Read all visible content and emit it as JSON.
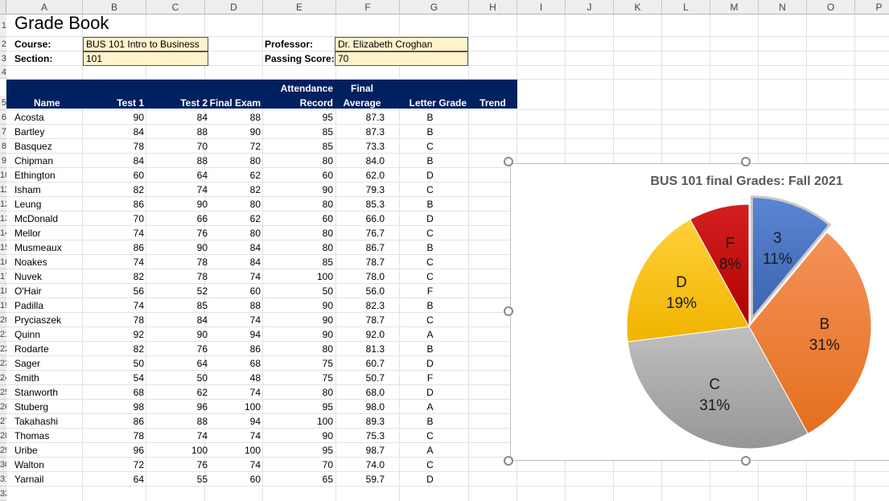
{
  "columns": [
    "A",
    "B",
    "C",
    "D",
    "E",
    "F",
    "G",
    "H",
    "I",
    "J",
    "K",
    "L",
    "M",
    "N",
    "O",
    "P"
  ],
  "row_numbers": [
    "1",
    "2",
    "3",
    "4",
    "5",
    "6",
    "7",
    "8",
    "9",
    "10",
    "11",
    "12",
    "13",
    "14",
    "15",
    "16",
    "17",
    "18",
    "19",
    "20",
    "21",
    "22",
    "23",
    "24",
    "25",
    "26",
    "27",
    "28",
    "29",
    "30",
    "31",
    "32"
  ],
  "title": "Grade Book",
  "info": {
    "course_label": "Course:",
    "course_value": "BUS 101 Intro to Business",
    "section_label": "Section:",
    "section_value": "101",
    "professor_label": "Professor:",
    "professor_value": "Dr. Elizabeth Croghan",
    "passing_label": "Passing Score:",
    "passing_value": "70"
  },
  "headers": {
    "name": "Name",
    "test1": "Test 1",
    "test2": "Test 2",
    "final_exam": "Final Exam",
    "attendance_line1": "Attendance",
    "attendance_line2": "Record",
    "final_avg_line1": "Final",
    "final_avg_line2": "Average",
    "letter_grade": "Letter Grade",
    "trend": "Trend"
  },
  "students": [
    [
      "Acosta",
      "90",
      "84",
      "88",
      "95",
      "87.3",
      "B"
    ],
    [
      "Bartley",
      "84",
      "88",
      "90",
      "85",
      "87.3",
      "B"
    ],
    [
      "Basquez",
      "78",
      "70",
      "72",
      "85",
      "73.3",
      "C"
    ],
    [
      "Chipman",
      "84",
      "88",
      "80",
      "80",
      "84.0",
      "B"
    ],
    [
      "Ethington",
      "60",
      "64",
      "62",
      "60",
      "62.0",
      "D"
    ],
    [
      "Isham",
      "82",
      "74",
      "82",
      "90",
      "79.3",
      "C"
    ],
    [
      "Leung",
      "86",
      "90",
      "80",
      "80",
      "85.3",
      "B"
    ],
    [
      "McDonald",
      "70",
      "66",
      "62",
      "60",
      "66.0",
      "D"
    ],
    [
      "Mellor",
      "74",
      "76",
      "80",
      "80",
      "76.7",
      "C"
    ],
    [
      "Musmeaux",
      "86",
      "90",
      "84",
      "80",
      "86.7",
      "B"
    ],
    [
      "Noakes",
      "74",
      "78",
      "84",
      "85",
      "78.7",
      "C"
    ],
    [
      "Nuvek",
      "82",
      "78",
      "74",
      "100",
      "78.0",
      "C"
    ],
    [
      "O'Hair",
      "56",
      "52",
      "60",
      "50",
      "56.0",
      "F"
    ],
    [
      "Padilla",
      "74",
      "85",
      "88",
      "90",
      "82.3",
      "B"
    ],
    [
      "Pryciaszek",
      "78",
      "84",
      "74",
      "90",
      "78.7",
      "C"
    ],
    [
      "Quinn",
      "92",
      "90",
      "94",
      "90",
      "92.0",
      "A"
    ],
    [
      "Rodarte",
      "82",
      "76",
      "86",
      "80",
      "81.3",
      "B"
    ],
    [
      "Sager",
      "50",
      "64",
      "68",
      "75",
      "60.7",
      "D"
    ],
    [
      "Smith",
      "54",
      "50",
      "48",
      "75",
      "50.7",
      "F"
    ],
    [
      "Stanworth",
      "68",
      "62",
      "74",
      "80",
      "68.0",
      "D"
    ],
    [
      "Stuberg",
      "98",
      "96",
      "100",
      "95",
      "98.0",
      "A"
    ],
    [
      "Takahashi",
      "86",
      "88",
      "94",
      "100",
      "89.3",
      "B"
    ],
    [
      "Thomas",
      "78",
      "74",
      "74",
      "90",
      "75.3",
      "C"
    ],
    [
      "Uribe",
      "96",
      "100",
      "100",
      "95",
      "98.7",
      "A"
    ],
    [
      "Walton",
      "72",
      "76",
      "74",
      "70",
      "74.0",
      "C"
    ],
    [
      "Yarnail",
      "64",
      "55",
      "60",
      "65",
      "59.7",
      "D"
    ]
  ],
  "chart_data": {
    "type": "pie",
    "title": "BUS 101 final Grades: Fall 2021",
    "slices": [
      {
        "label": "3",
        "percent_label": "11%",
        "value": 11,
        "color": "#4472c4",
        "exploded": true
      },
      {
        "label": "B",
        "percent_label": "31%",
        "value": 31,
        "color": "#ed7d31"
      },
      {
        "label": "C",
        "percent_label": "31%",
        "value": 31,
        "color": "#a5a5a5"
      },
      {
        "label": "D",
        "percent_label": "19%",
        "value": 19,
        "color": "#ffc000"
      },
      {
        "label": "F",
        "percent_label": "8%",
        "value": 8,
        "color": "#c00000"
      }
    ],
    "legend": "none"
  }
}
